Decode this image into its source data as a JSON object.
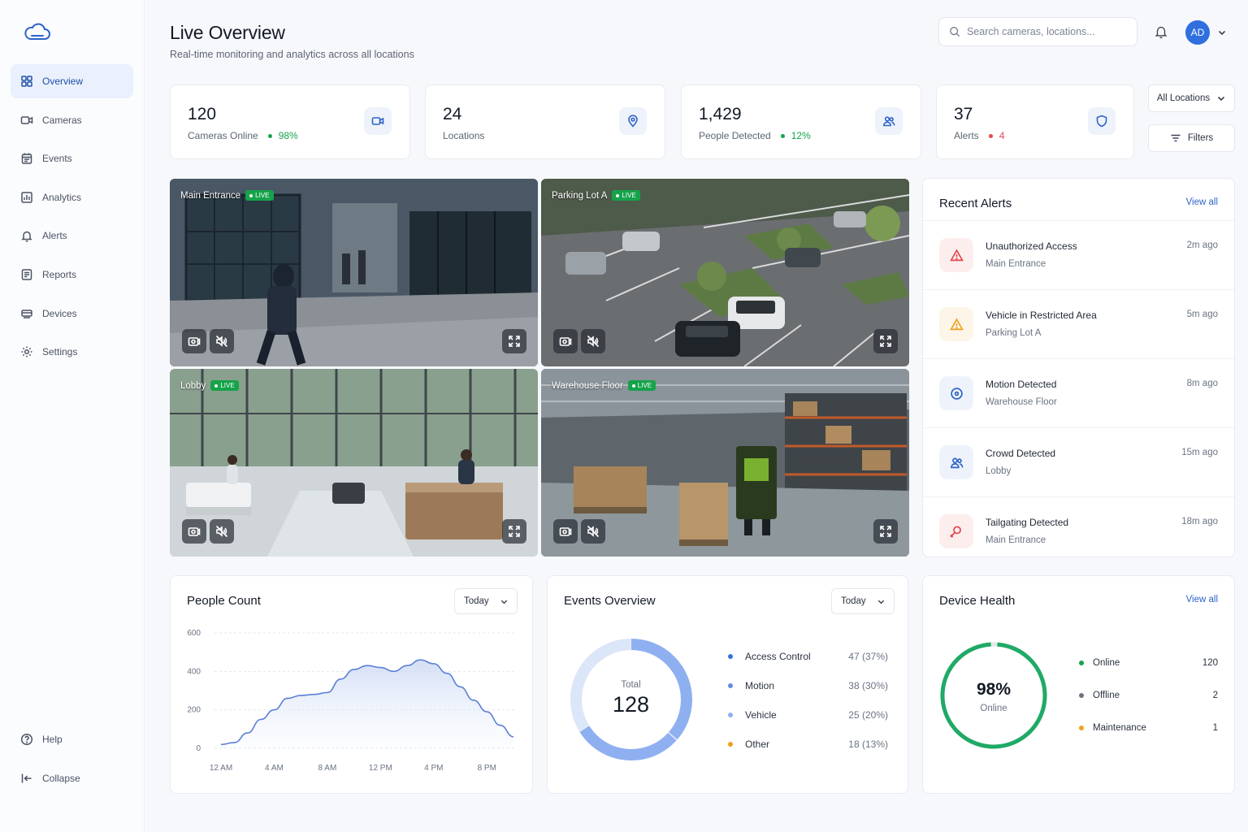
{
  "header": {
    "title": "Live Overview",
    "subtitle": "Real-time monitoring and analytics across all locations",
    "search_placeholder": "Search cameras, locations...",
    "avatar_initials": "AD"
  },
  "sidebar": {
    "items": [
      {
        "label": "Overview",
        "icon": "grid-icon",
        "active": true
      },
      {
        "label": "Cameras",
        "icon": "video-icon"
      },
      {
        "label": "Events",
        "icon": "calendar-icon"
      },
      {
        "label": "Analytics",
        "icon": "bar-chart-icon"
      },
      {
        "label": "Alerts",
        "icon": "bell-icon"
      },
      {
        "label": "Reports",
        "icon": "report-icon"
      },
      {
        "label": "Devices",
        "icon": "device-icon"
      },
      {
        "label": "Settings",
        "icon": "gear-icon"
      }
    ],
    "bottom": [
      {
        "label": "Help",
        "icon": "help-icon"
      },
      {
        "label": "Collapse",
        "icon": "collapse-icon"
      }
    ]
  },
  "stats": [
    {
      "value": "120",
      "label": "Cameras Online",
      "delta": "98%",
      "delta_color": "#16a34a",
      "icon": "video-icon"
    },
    {
      "value": "24",
      "label": "Locations",
      "delta": "",
      "icon": "map-pin-icon"
    },
    {
      "value": "1,429",
      "label": "People Detected",
      "delta": "12%",
      "delta_color": "#16a34a",
      "icon": "users-icon"
    },
    {
      "value": "37",
      "label": "Alerts",
      "delta": "4",
      "delta_color": "#e5484d",
      "icon": "shield-icon"
    }
  ],
  "controls": {
    "locations": "All Locations",
    "filters": "Filters"
  },
  "cameras": [
    {
      "name": "Main Entrance",
      "live": "LIVE"
    },
    {
      "name": "Parking Lot A",
      "live": "LIVE"
    },
    {
      "name": "Lobby",
      "live": "LIVE"
    },
    {
      "name": "Warehouse Floor",
      "live": "LIVE"
    }
  ],
  "recent_alerts": {
    "title": "Recent Alerts",
    "view_all": "View all",
    "items": [
      {
        "title": "Unauthorized Access",
        "location": "Main Entrance",
        "time": "2m ago",
        "icon": "alert-triangle-icon",
        "color": "#e5484d",
        "bg": "#fdeeee"
      },
      {
        "title": "Vehicle in Restricted Area",
        "location": "Parking Lot A",
        "time": "5m ago",
        "icon": "warning-icon",
        "color": "#f0a020",
        "bg": "#fdf6e8"
      },
      {
        "title": "Motion Detected",
        "location": "Warehouse Floor",
        "time": "8m ago",
        "icon": "target-icon",
        "color": "#2f63c9",
        "bg": "#eef3fb"
      },
      {
        "title": "Crowd Detected",
        "location": "Lobby",
        "time": "15m ago",
        "icon": "users-icon",
        "color": "#2f63c9",
        "bg": "#eef3fb"
      },
      {
        "title": "Tailgating Detected",
        "location": "Main Entrance",
        "time": "18m ago",
        "icon": "tailgate-icon",
        "color": "#e5484d",
        "bg": "#fdeeee"
      }
    ]
  },
  "people_count": {
    "title": "People Count",
    "range": "Today"
  },
  "events_overview": {
    "title": "Events Overview",
    "range": "Today",
    "total_label": "Total",
    "total": "128"
  },
  "device_health": {
    "title": "Device Health",
    "view_all": "View all",
    "percent": "98%",
    "percent_label": "Online",
    "online_fraction": 0.98,
    "items": [
      {
        "label": "Online",
        "value": "120",
        "color": "#16a34a"
      },
      {
        "label": "Offline",
        "value": "2",
        "color": "#6b7280"
      },
      {
        "label": "Maintenance",
        "value": "1",
        "color": "#f0a020"
      }
    ]
  },
  "chart_data": [
    {
      "type": "area",
      "x": [
        "12 AM",
        "1 AM",
        "2 AM",
        "3 AM",
        "4 AM",
        "5 AM",
        "6 AM",
        "7 AM",
        "8 AM",
        "9 AM",
        "10 AM",
        "11 AM",
        "12 PM",
        "1 PM",
        "2 PM",
        "3 PM",
        "4 PM",
        "5 PM",
        "6 PM",
        "7 PM",
        "8 PM",
        "9 PM",
        "10 PM"
      ],
      "x_ticks": [
        "12 AM",
        "4 AM",
        "8 AM",
        "12 PM",
        "4 PM",
        "8 PM"
      ],
      "series": [
        {
          "values": [
            20,
            30,
            80,
            150,
            200,
            260,
            275,
            280,
            290,
            360,
            410,
            430,
            420,
            400,
            430,
            460,
            440,
            390,
            320,
            250,
            190,
            120,
            60
          ]
        }
      ],
      "ylim": [
        0,
        600
      ],
      "y_ticks": [
        0,
        200,
        400,
        600
      ],
      "grid": true,
      "color": "#5b7fd6"
    },
    {
      "type": "pie",
      "donut": true,
      "categories": [
        "Access Control",
        "Motion",
        "Vehicle",
        "Other"
      ],
      "values": [
        47,
        38,
        25,
        18
      ],
      "value_labels": [
        "47 (37%)",
        "38 (30%)",
        "25 (20%)",
        "18 (13%)"
      ],
      "colors": [
        "#3b6fe0",
        "#5f8ce8",
        "#8fb0f0",
        "#f0a020"
      ],
      "ring_colors": [
        "#8fb0f0",
        "#8fb0f0",
        "#dce6f9",
        "#dce6f9"
      ]
    }
  ]
}
